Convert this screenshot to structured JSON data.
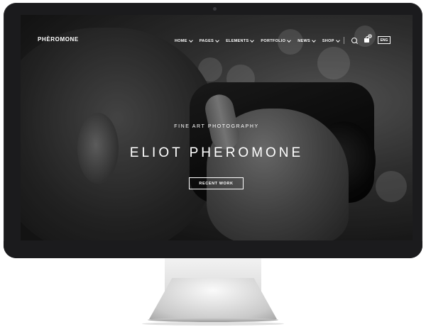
{
  "site": {
    "logo": "PHÈROMONE",
    "nav": [
      {
        "label": "HOME"
      },
      {
        "label": "PAGES"
      },
      {
        "label": "ELEMENTS"
      },
      {
        "label": "PORTFOLIO"
      },
      {
        "label": "NEWS"
      },
      {
        "label": "SHOP"
      }
    ],
    "cart_count": "1",
    "language": "ENG"
  },
  "hero": {
    "subtitle": "FINE ART PHOTOGRAPHY",
    "title": "ELIOT PHEROMONE",
    "button_label": "RECENT WORK"
  },
  "icons": {
    "search": "search-icon",
    "cart": "cart-icon",
    "chevron": "chevron-down-icon"
  }
}
